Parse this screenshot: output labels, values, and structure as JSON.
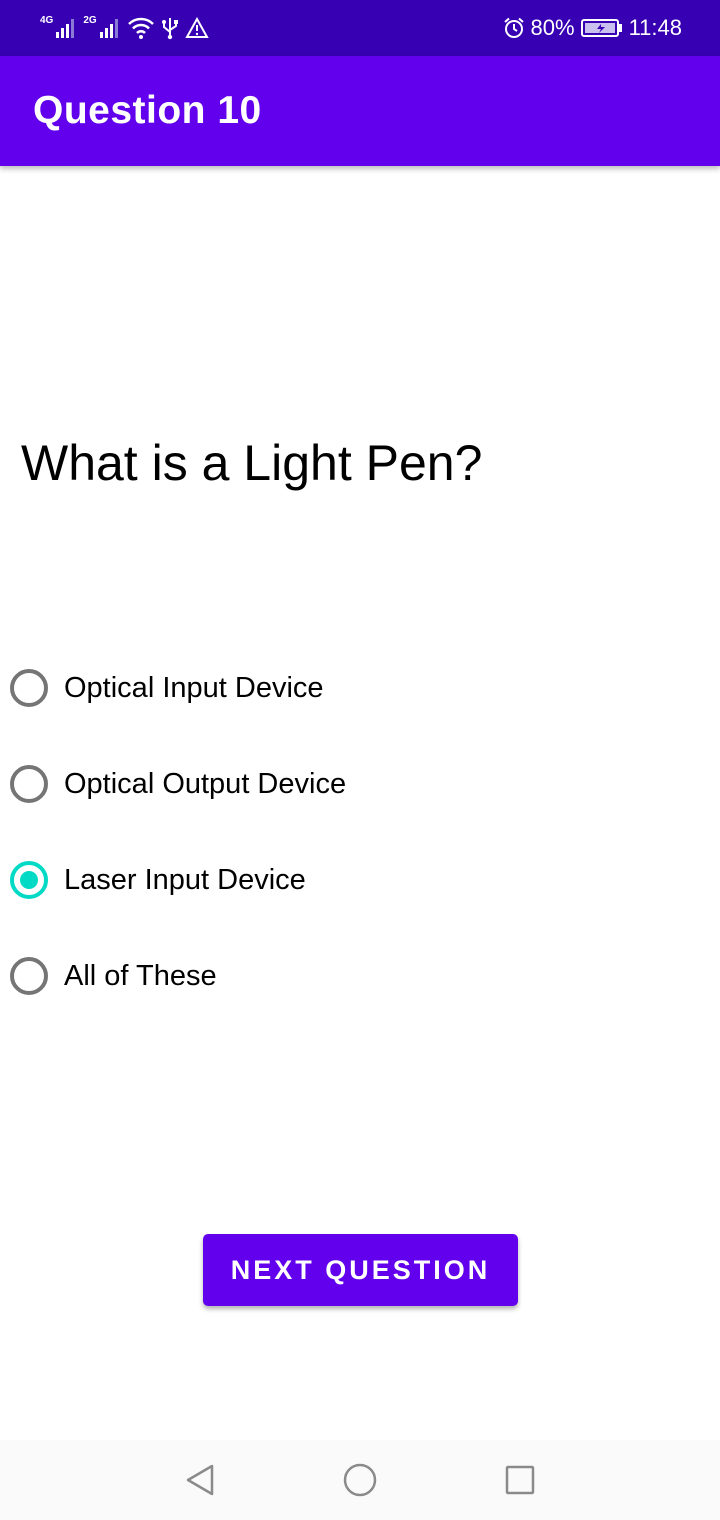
{
  "status_bar": {
    "signal1_label": "4G",
    "signal2_label": "2G",
    "battery": "80%",
    "time": "11:48",
    "icons": [
      "signal-4g-icon",
      "signal-2g-icon",
      "wifi-icon",
      "usb-icon",
      "warning-icon",
      "alarm-icon",
      "battery-charging-icon"
    ]
  },
  "app_bar": {
    "title": "Question 10"
  },
  "quiz": {
    "question": "What is a Light Pen?",
    "options": [
      {
        "label": "Optical Input Device",
        "selected": false
      },
      {
        "label": "Optical Output Device",
        "selected": false
      },
      {
        "label": "Laser Input Device",
        "selected": true
      },
      {
        "label": "All of These",
        "selected": false
      }
    ],
    "next_button": "NEXT QUESTION"
  },
  "nav_bar": {
    "icons": [
      "back-icon",
      "home-icon",
      "recents-icon"
    ]
  },
  "colors": {
    "status_bar": "#3700b3",
    "primary": "#6200ee",
    "accent": "#03dac5",
    "radio_unchecked": "#757575"
  }
}
